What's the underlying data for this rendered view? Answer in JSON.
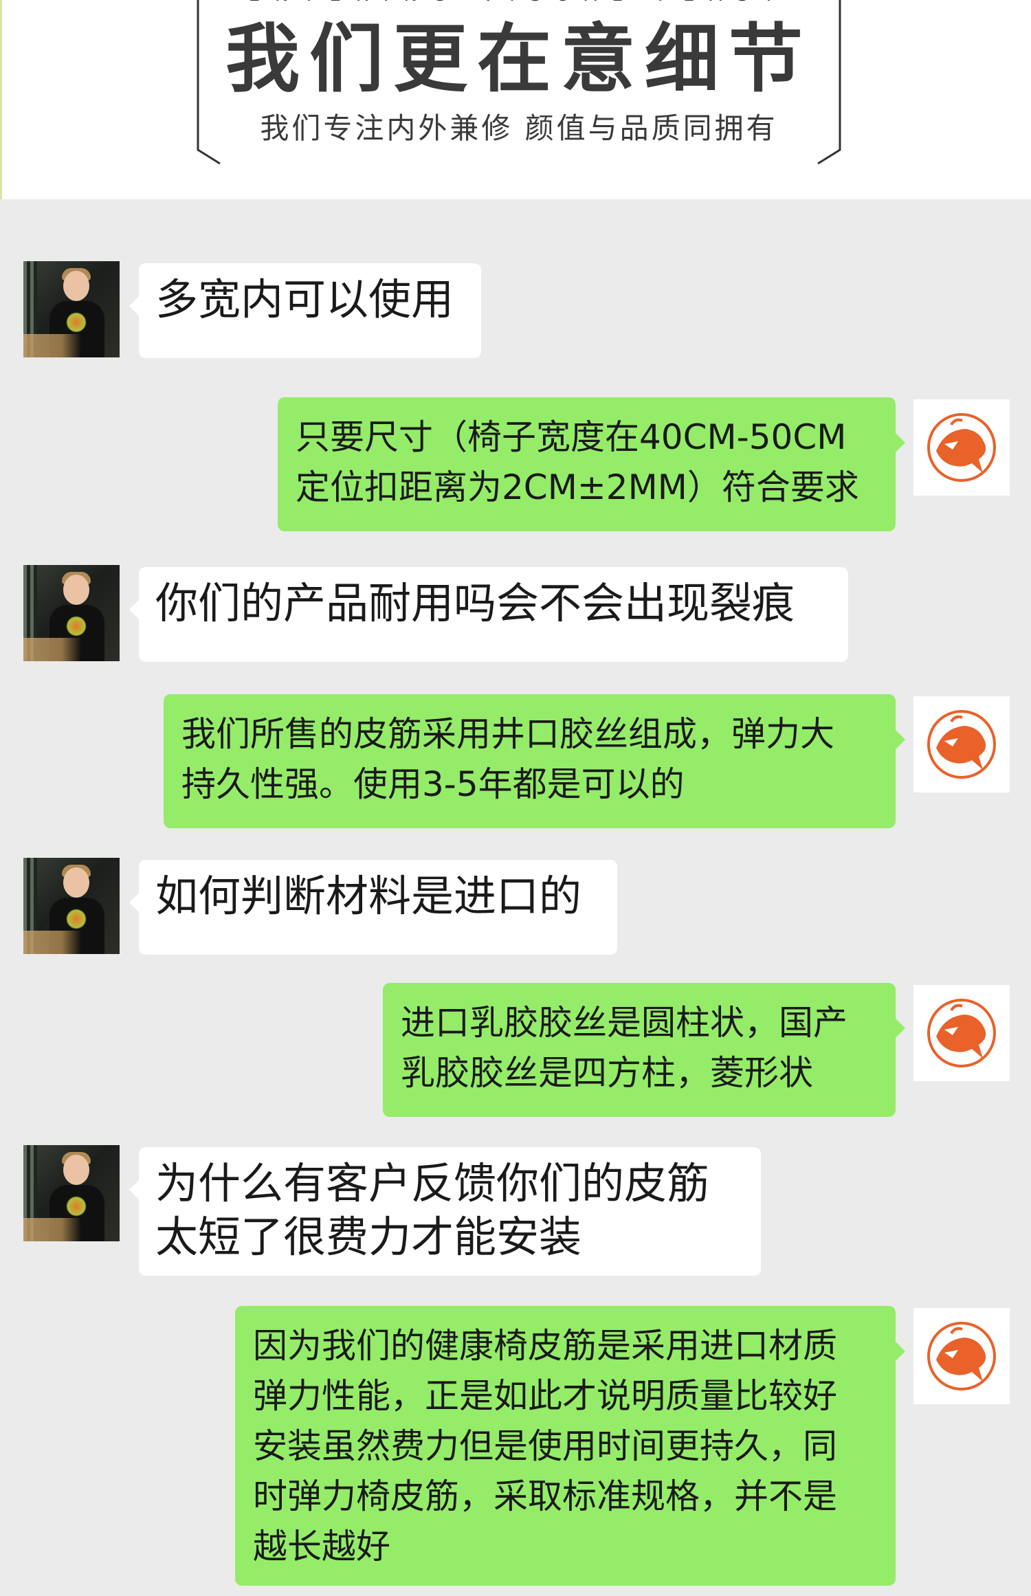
{
  "header": {
    "english_text": "ENTERING VISUAL FEAST",
    "title": "我们更在意细节",
    "subtitle": "我们专注内外兼修 颜值与品质同拥有"
  },
  "colors": {
    "chat_background": "#ebebeb",
    "sent_bubble": "#95ec69",
    "received_bubble": "#ffffff",
    "logo_orange": "#e8622a"
  },
  "messages": [
    {
      "from": "customer",
      "avatar_icon": "boy-photo-avatar",
      "lines": [
        "多宽内可以使用"
      ]
    },
    {
      "from": "seller",
      "avatar_icon": "orange-horse-logo",
      "lines": [
        "只要尺寸（椅子宽度在40CM-50CM",
        "定位扣距离为2CM±2MM）符合要求"
      ]
    },
    {
      "from": "customer",
      "avatar_icon": "boy-photo-avatar",
      "lines": [
        "你们的产品耐用吗会不会出现裂痕"
      ]
    },
    {
      "from": "seller",
      "avatar_icon": "orange-horse-logo",
      "lines": [
        "我们所售的皮筋采用井口胶丝组成，弹力大",
        "持久性强。使用3-5年都是可以的"
      ]
    },
    {
      "from": "customer",
      "avatar_icon": "boy-photo-avatar",
      "lines": [
        "如何判断材料是进口的"
      ]
    },
    {
      "from": "seller",
      "avatar_icon": "orange-horse-logo",
      "lines": [
        "进口乳胶胶丝是圆柱状，国产",
        "乳胶胶丝是四方柱，菱形状"
      ]
    },
    {
      "from": "customer",
      "avatar_icon": "boy-photo-avatar",
      "lines": [
        "为什么有客户反馈你们的皮筋",
        "太短了很费力才能安装"
      ]
    },
    {
      "from": "seller",
      "avatar_icon": "orange-horse-logo",
      "lines": [
        "因为我们的健康椅皮筋是采用进口材质",
        "弹力性能，正是如此才说明质量比较好",
        "安装虽然费力但是使用时间更持久，同",
        "时弹力椅皮筋，采取标准规格，并不是",
        "越长越好"
      ]
    }
  ]
}
